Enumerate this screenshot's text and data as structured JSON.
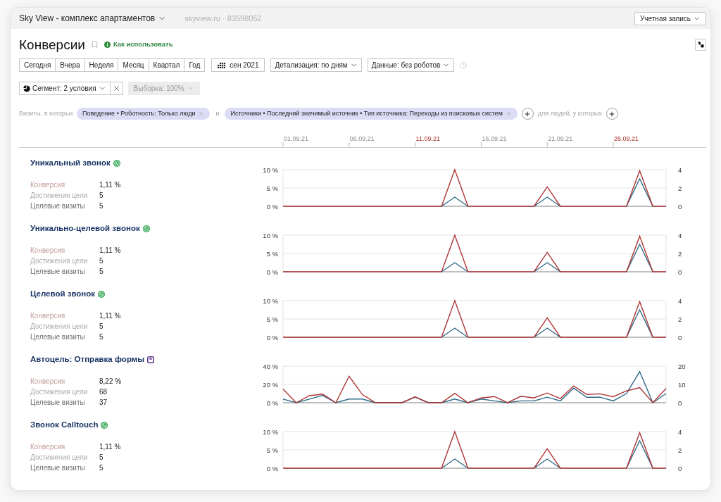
{
  "header": {
    "site": "Sky View - комплекс апартаментов",
    "counter": "skyview.ru · 83598052",
    "account_button": "Учетная запись"
  },
  "report": {
    "title": "Конверсии",
    "help_link": "Как использовать"
  },
  "periods": [
    {
      "label": "Сегодня",
      "selected": false
    },
    {
      "label": "Вчера",
      "selected": false
    },
    {
      "label": "Неделя",
      "selected": false
    },
    {
      "label": "Месяц",
      "selected": false
    },
    {
      "label": "Квартал",
      "selected": false
    },
    {
      "label": "Год",
      "selected": false
    }
  ],
  "date_button": "сен 2021",
  "dropdowns": [
    "Детализация: по дням",
    "Данные: без роботов"
  ],
  "segment": {
    "label": "Сегмент: 2 условия",
    "sample": "Выборка: 100%"
  },
  "filters": {
    "prefix": "Визиты, в которых",
    "chips": [
      "Поведение • Роботность: Только люди",
      "Источники • Последний значимый источник • Тип источника: Переходы из поисковых систем"
    ],
    "conjunction": "и",
    "suffix": "для людей, у которых"
  },
  "date_axis": {
    "xticks": [
      {
        "label": "01.09.21",
        "weekend": false
      },
      {
        "label": "06.09.21",
        "weekend": false
      },
      {
        "label": "11.09.21",
        "weekend": true
      },
      {
        "label": "16.09.21",
        "weekend": false
      },
      {
        "label": "21.09.21",
        "weekend": false
      },
      {
        "label": "26.09.21",
        "weekend": true
      }
    ]
  },
  "goals": [
    {
      "title": "Уникальный звонок",
      "kind": "call",
      "stats": [
        {
          "label": "Конверсия",
          "value": "1,11 %",
          "color": "#c49c9c"
        },
        {
          "label": "Достижения цели",
          "value": "5",
          "color": "#ababab"
        },
        {
          "label": "Целевые визиты",
          "value": "5",
          "color": "#707070"
        }
      ],
      "chart_data": {
        "type": "line",
        "ylim": [
          0,
          10
        ],
        "yticks": [
          {
            "value": 0,
            "label": "0 %"
          },
          {
            "value": 5,
            "label": "5 %"
          },
          {
            "value": 10,
            "label": "10 %"
          }
        ],
        "y2lim": [
          0,
          4
        ],
        "y2ticks": [
          0,
          2,
          4
        ],
        "series": [
          {
            "color": "#2e6a88",
            "axis": "y2",
            "values": [
              null,
              null,
              null,
              null,
              null,
              null,
              null,
              null,
              null,
              null,
              null,
              null,
              0,
              1,
              0,
              null,
              null,
              null,
              null,
              0,
              1,
              0,
              null,
              null,
              null,
              null,
              0,
              3,
              0,
              null
            ]
          },
          {
            "color": "#ad3434",
            "values": [
              0,
              0,
              0,
              0,
              0,
              0,
              0,
              0,
              0,
              0,
              0,
              0,
              0,
              10,
              0,
              0,
              0,
              0,
              0,
              0,
              5.3,
              0,
              0,
              0,
              0,
              0,
              0,
              9.7,
              0,
              0
            ]
          }
        ]
      }
    },
    {
      "title": "Уникально-целевой звонок",
      "kind": "call",
      "stats": [
        {
          "label": "Конверсия",
          "value": "1,11 %",
          "color": "#c49c9c"
        },
        {
          "label": "Достижения цели",
          "value": "5",
          "color": "#ababab"
        },
        {
          "label": "Целевые визиты",
          "value": "5",
          "color": "#707070"
        }
      ],
      "chart_data": {
        "type": "line",
        "ylim": [
          0,
          10
        ],
        "yticks": [
          {
            "value": 0,
            "label": "0 %"
          },
          {
            "value": 5,
            "label": "5 %"
          },
          {
            "value": 10,
            "label": "10 %"
          }
        ],
        "y2lim": [
          0,
          4
        ],
        "y2ticks": [
          0,
          2,
          4
        ],
        "series": [
          {
            "color": "#2e6a88",
            "axis": "y2",
            "values": [
              null,
              null,
              null,
              null,
              null,
              null,
              null,
              null,
              null,
              null,
              null,
              null,
              0,
              1,
              0,
              null,
              null,
              null,
              null,
              0,
              1,
              0,
              null,
              null,
              null,
              null,
              0,
              3,
              0,
              null
            ]
          },
          {
            "color": "#ad3434",
            "values": [
              0,
              0,
              0,
              0,
              0,
              0,
              0,
              0,
              0,
              0,
              0,
              0,
              0,
              10,
              0,
              0,
              0,
              0,
              0,
              0,
              5.3,
              0,
              0,
              0,
              0,
              0,
              0,
              9.7,
              0,
              0
            ]
          }
        ]
      }
    },
    {
      "title": "Целевой звонок",
      "kind": "call",
      "stats": [
        {
          "label": "Конверсия",
          "value": "1,11 %",
          "color": "#c49c9c"
        },
        {
          "label": "Достижения цели",
          "value": "5",
          "color": "#ababab"
        },
        {
          "label": "Целевые визиты",
          "value": "5",
          "color": "#707070"
        }
      ],
      "chart_data": {
        "type": "line",
        "ylim": [
          0,
          10
        ],
        "yticks": [
          {
            "value": 0,
            "label": "0 %"
          },
          {
            "value": 5,
            "label": "5 %"
          },
          {
            "value": 10,
            "label": "10 %"
          }
        ],
        "y2lim": [
          0,
          4
        ],
        "y2ticks": [
          0,
          2,
          4
        ],
        "series": [
          {
            "color": "#2e6a88",
            "axis": "y2",
            "values": [
              null,
              null,
              null,
              null,
              null,
              null,
              null,
              null,
              null,
              null,
              null,
              null,
              0,
              1,
              0,
              null,
              null,
              null,
              null,
              0,
              1,
              0,
              null,
              null,
              null,
              null,
              0,
              3,
              0,
              null
            ]
          },
          {
            "color": "#ad3434",
            "values": [
              0,
              0,
              0,
              0,
              0,
              0,
              0,
              0,
              0,
              0,
              0,
              0,
              0,
              10,
              0,
              0,
              0,
              0,
              0,
              0,
              5.3,
              0,
              0,
              0,
              0,
              0,
              0,
              9.7,
              0,
              0
            ]
          }
        ]
      }
    },
    {
      "title": "Автоцель: Отправка формы",
      "kind": "form",
      "stats": [
        {
          "label": "Конверсия",
          "value": "8,22 %",
          "color": "#c49c9c"
        },
        {
          "label": "Достижения цели",
          "value": "68",
          "color": "#ababab"
        },
        {
          "label": "Целевые визиты",
          "value": "37",
          "color": "#707070"
        }
      ],
      "chart_data": {
        "type": "line",
        "ylim": [
          0,
          40
        ],
        "yticks": [
          {
            "value": 0,
            "label": "0 %"
          },
          {
            "value": 20,
            "label": "20 %"
          },
          {
            "value": 40,
            "label": "40 %"
          }
        ],
        "y2lim": [
          0,
          20
        ],
        "y2ticks": [
          0,
          10,
          20
        ],
        "series": [
          {
            "color": "#2e6a88",
            "axis": "y2",
            "values": [
              2,
              0,
              2,
              4,
              0,
              2,
              2,
              0,
              0,
              0,
              3,
              0,
              0,
              2,
              0,
              2,
              1,
              0,
              1,
              1,
              3,
              1,
              8,
              3,
              3,
              1,
              5,
              17,
              0,
              5
            ]
          },
          {
            "color": "#ad3434",
            "values": [
              14.8,
              0,
              7.7,
              9.4,
              0,
              29,
              9,
              0,
              0,
              0,
              6.5,
              0,
              0,
              10.3,
              0,
              5.2,
              6.8,
              0,
              7.1,
              5.2,
              10.6,
              4.5,
              18.4,
              9,
              9.7,
              6.5,
              12.9,
              16.5,
              0,
              15.5
            ]
          }
        ]
      }
    },
    {
      "title": "Звонок Calltouch",
      "kind": "call",
      "stats": [
        {
          "label": "Конверсия",
          "value": "1,11 %",
          "color": "#c49c9c"
        },
        {
          "label": "Достижения цели",
          "value": "5",
          "color": "#ababab"
        },
        {
          "label": "Целевые визиты",
          "value": "5",
          "color": "#707070"
        }
      ],
      "chart_data": {
        "type": "line",
        "ylim": [
          0,
          10
        ],
        "yticks": [
          {
            "value": 0,
            "label": "0 %"
          },
          {
            "value": 5,
            "label": "5 %"
          },
          {
            "value": 10,
            "label": "10 %"
          }
        ],
        "y2lim": [
          0,
          4
        ],
        "y2ticks": [
          0,
          2,
          4
        ],
        "series": [
          {
            "color": "#2e6a88",
            "axis": "y2",
            "values": [
              null,
              null,
              null,
              null,
              null,
              null,
              null,
              null,
              null,
              null,
              null,
              null,
              0,
              1,
              0,
              null,
              null,
              null,
              null,
              0,
              1,
              0,
              null,
              null,
              null,
              null,
              0,
              3,
              0,
              null
            ]
          },
          {
            "color": "#ad3434",
            "values": [
              0,
              0,
              0,
              0,
              0,
              0,
              0,
              0,
              0,
              0,
              0,
              0,
              0,
              10,
              0,
              0,
              0,
              0,
              0,
              0,
              5.3,
              0,
              0,
              0,
              0,
              0,
              0,
              9.7,
              0,
              0
            ]
          }
        ]
      }
    }
  ]
}
